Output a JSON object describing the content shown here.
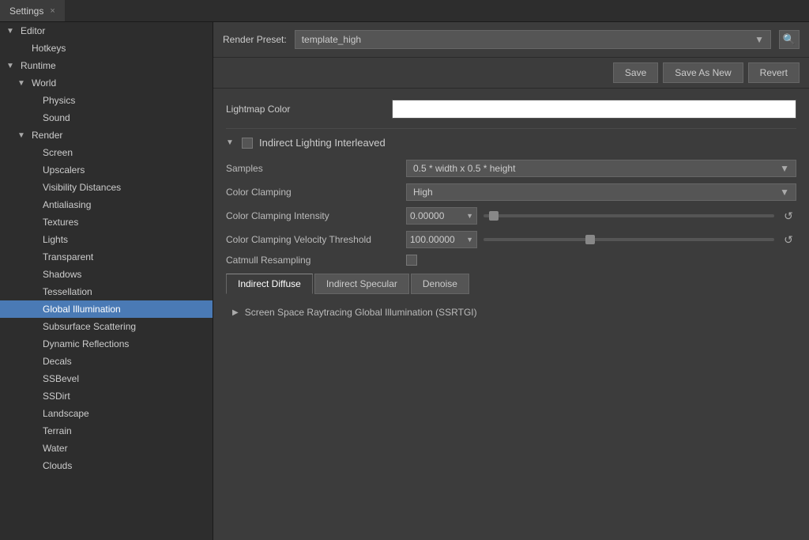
{
  "titleBar": {
    "tabLabel": "Settings",
    "closeLabel": "×"
  },
  "sidebar": {
    "items": [
      {
        "id": "editor",
        "label": "Editor",
        "level": 0,
        "arrow": "▼",
        "selected": false
      },
      {
        "id": "hotkeys",
        "label": "Hotkeys",
        "level": 1,
        "arrow": "",
        "selected": false
      },
      {
        "id": "runtime",
        "label": "Runtime",
        "level": 0,
        "arrow": "▼",
        "selected": false
      },
      {
        "id": "world",
        "label": "World",
        "level": 1,
        "arrow": "▼",
        "selected": false
      },
      {
        "id": "physics",
        "label": "Physics",
        "level": 2,
        "arrow": "",
        "selected": false
      },
      {
        "id": "sound",
        "label": "Sound",
        "level": 2,
        "arrow": "",
        "selected": false
      },
      {
        "id": "render",
        "label": "Render",
        "level": 1,
        "arrow": "▼",
        "selected": false
      },
      {
        "id": "screen",
        "label": "Screen",
        "level": 2,
        "arrow": "",
        "selected": false
      },
      {
        "id": "upscalers",
        "label": "Upscalers",
        "level": 2,
        "arrow": "",
        "selected": false
      },
      {
        "id": "visibility-distances",
        "label": "Visibility Distances",
        "level": 2,
        "arrow": "",
        "selected": false
      },
      {
        "id": "antialiasing",
        "label": "Antialiasing",
        "level": 2,
        "arrow": "",
        "selected": false
      },
      {
        "id": "textures",
        "label": "Textures",
        "level": 2,
        "arrow": "",
        "selected": false
      },
      {
        "id": "lights",
        "label": "Lights",
        "level": 2,
        "arrow": "",
        "selected": false
      },
      {
        "id": "transparent",
        "label": "Transparent",
        "level": 2,
        "arrow": "",
        "selected": false
      },
      {
        "id": "shadows",
        "label": "Shadows",
        "level": 2,
        "arrow": "",
        "selected": false
      },
      {
        "id": "tessellation",
        "label": "Tessellation",
        "level": 2,
        "arrow": "",
        "selected": false
      },
      {
        "id": "global-illumination",
        "label": "Global Illumination",
        "level": 2,
        "arrow": "",
        "selected": true
      },
      {
        "id": "subsurface-scattering",
        "label": "Subsurface Scattering",
        "level": 2,
        "arrow": "",
        "selected": false
      },
      {
        "id": "dynamic-reflections",
        "label": "Dynamic Reflections",
        "level": 2,
        "arrow": "",
        "selected": false
      },
      {
        "id": "decals",
        "label": "Decals",
        "level": 2,
        "arrow": "",
        "selected": false
      },
      {
        "id": "ssbevel",
        "label": "SSBevel",
        "level": 2,
        "arrow": "",
        "selected": false
      },
      {
        "id": "ssdirt",
        "label": "SSDirt",
        "level": 2,
        "arrow": "",
        "selected": false
      },
      {
        "id": "landscape",
        "label": "Landscape",
        "level": 2,
        "arrow": "",
        "selected": false
      },
      {
        "id": "terrain",
        "label": "Terrain",
        "level": 2,
        "arrow": "",
        "selected": false
      },
      {
        "id": "water",
        "label": "Water",
        "level": 2,
        "arrow": "",
        "selected": false
      },
      {
        "id": "clouds",
        "label": "Clouds",
        "level": 2,
        "arrow": "",
        "selected": false
      }
    ]
  },
  "presetBar": {
    "label": "Render Preset:",
    "value": "template_high",
    "searchIcon": "🔍"
  },
  "actionButtons": {
    "save": "Save",
    "saveAsNew": "Save As New",
    "revert": "Revert"
  },
  "content": {
    "lightmapColorLabel": "Lightmap Color",
    "section": {
      "collapseArrow": "▼",
      "title": "Indirect Lighting Interleaved"
    },
    "samplesLabel": "Samples",
    "samplesValue": "0.5 * width x 0.5 * height",
    "colorClampingLabel": "Color Clamping",
    "colorClampingValue": "High",
    "colorClampingIntensityLabel": "Color Clamping Intensity",
    "colorClampingIntensityValue": "0.00000",
    "colorClampingVelocityLabel": "Color Clamping Velocity Threshold",
    "colorClampingVelocityValue": "100.00000",
    "catmullResamplingLabel": "Catmull Resampling",
    "tabs": [
      {
        "id": "indirect-diffuse",
        "label": "Indirect Diffuse",
        "active": true
      },
      {
        "id": "indirect-specular",
        "label": "Indirect Specular",
        "active": false
      },
      {
        "id": "denoise",
        "label": "Denoise",
        "active": false
      }
    ],
    "ssrtgiLabel": "Screen Space Raytracing Global Illumination (SSRTGI)",
    "ssrtgiArrow": "▶"
  }
}
